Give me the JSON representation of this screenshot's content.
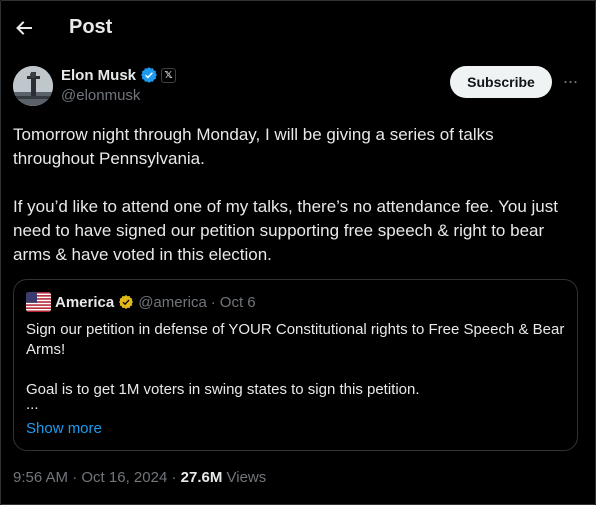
{
  "header": {
    "title": "Post",
    "back_icon": "arrow-left-icon"
  },
  "author": {
    "name": "Elon Musk",
    "handle": "@elonmusk",
    "verified_badge_color": "#1d9bf0",
    "affiliate_icon": "x-logo-icon"
  },
  "actions": {
    "subscribe_label": "Subscribe",
    "more_label": "···"
  },
  "post": {
    "paragraphs": [
      "Tomorrow night through Monday, I will be giving a series of talks throughout Pennsylvania.",
      "If you’d like to attend one of my talks, there’s no attendance fee. You just need to have signed our petition supporting free speech & right to bear arms & have voted in this election."
    ],
    "time": "9:56 AM",
    "date": "Oct 16, 2024",
    "views_count": "27.6M",
    "views_label": "Views",
    "separator": "·"
  },
  "quote": {
    "name": "America",
    "handle": "@america",
    "separator": "·",
    "date": "Oct 6",
    "badge_color": "#e2b719",
    "paragraphs": [
      "Sign our petition in defense of YOUR Constitutional rights to Free Speech & Bear Arms!",
      "Goal is to get 1M voters in swing states to sign this petition."
    ],
    "ellipsis": "...",
    "show_more": "Show more"
  },
  "colors": {
    "background": "#000000",
    "text_primary": "#e7e9ea",
    "text_secondary": "#71767b",
    "link": "#1d9bf0",
    "border": "#2f3336"
  }
}
